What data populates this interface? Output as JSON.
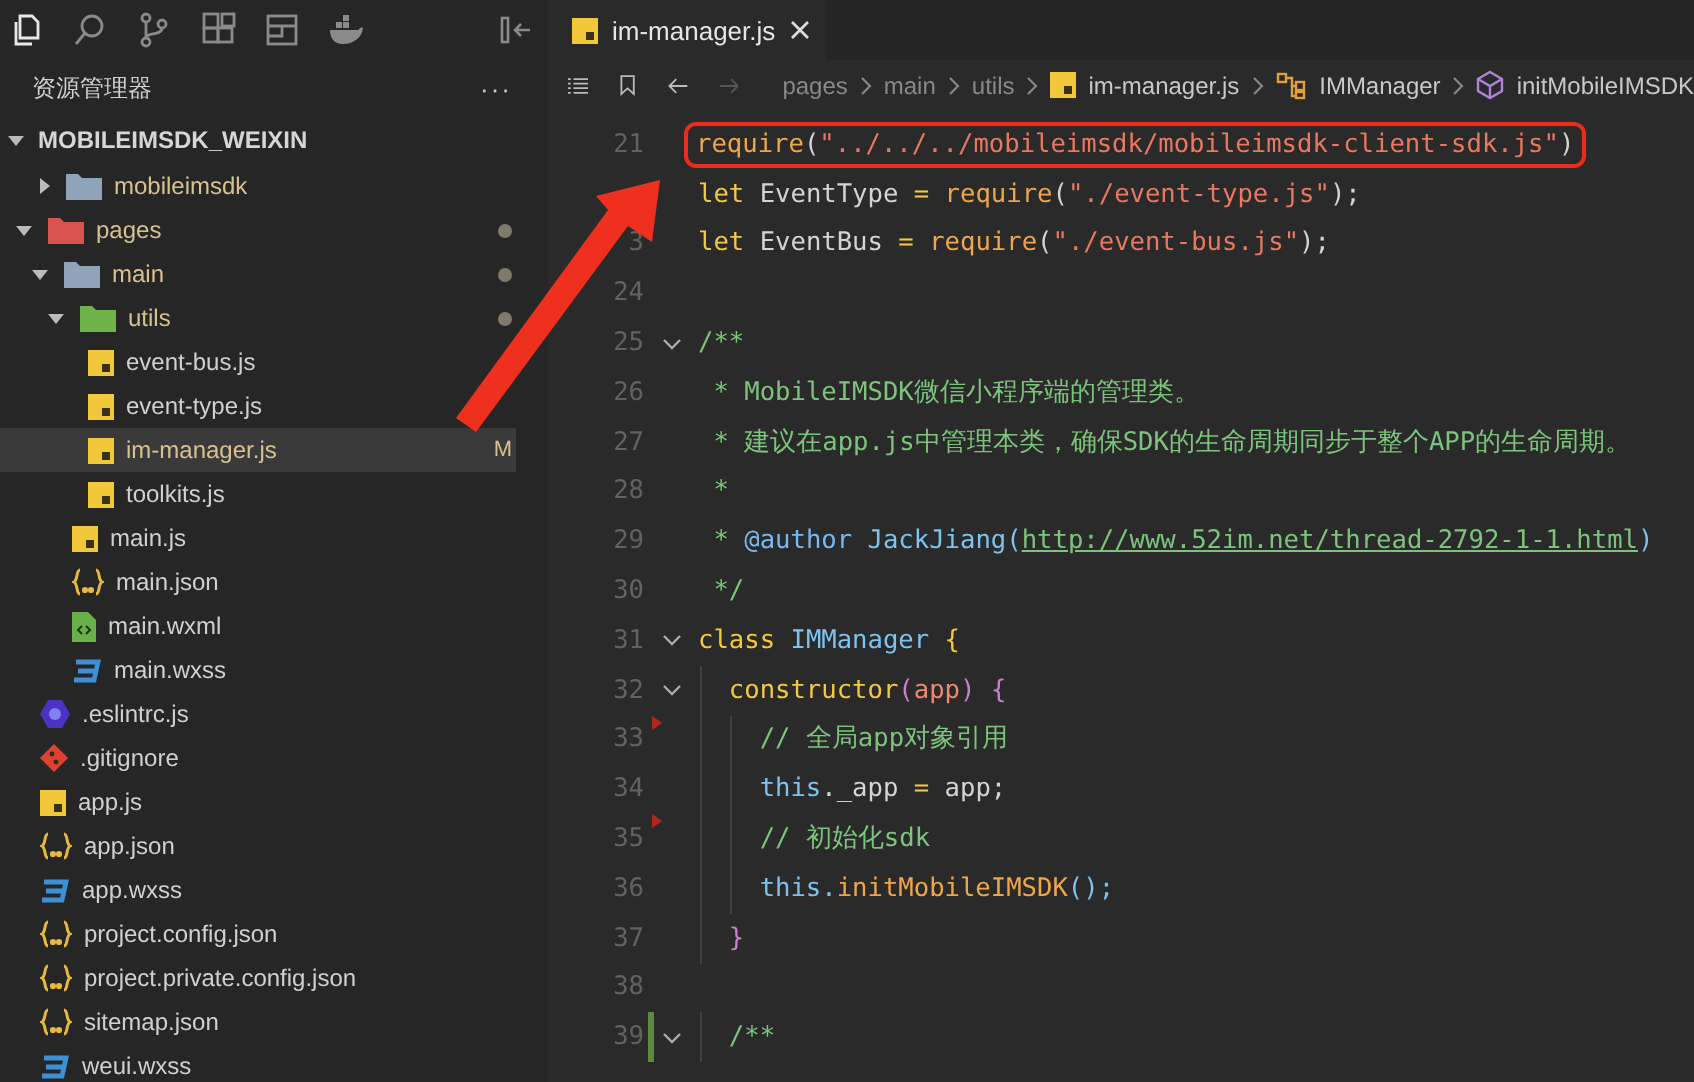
{
  "activity_bar": {
    "icons": [
      {
        "kind": "files",
        "selected": true
      },
      {
        "kind": "search",
        "selected": false
      },
      {
        "kind": "branch",
        "selected": false
      },
      {
        "kind": "extensions",
        "selected": false
      },
      {
        "kind": "panel",
        "selected": false
      },
      {
        "kind": "whale",
        "selected": false
      }
    ]
  },
  "sidebar": {
    "title": "资源管理器",
    "more": "···",
    "root": {
      "label": "MOBILEIMSDK_WEIXIN",
      "expanded": true
    },
    "items": [
      {
        "label": "mobileimsdk",
        "kind": "folder",
        "expanded": false,
        "modified": true,
        "selected": false
      },
      {
        "label": "pages",
        "kind": "folder-pages",
        "expanded": true,
        "modified": true,
        "selected": false,
        "children": [
          {
            "label": "main",
            "kind": "folder",
            "expanded": true,
            "modified": true,
            "selected": false,
            "children": [
              {
                "label": "utils",
                "kind": "folder-utils",
                "expanded": true,
                "modified": true,
                "selected": false,
                "children": [
                  {
                    "label": "event-bus.js",
                    "kind": "js",
                    "modified": false,
                    "selected": false
                  },
                  {
                    "label": "event-type.js",
                    "kind": "js",
                    "modified": false,
                    "selected": false
                  },
                  {
                    "label": "im-manager.js",
                    "kind": "js",
                    "modified": true,
                    "badge": "M",
                    "selected": true
                  },
                  {
                    "label": "toolkits.js",
                    "kind": "js",
                    "modified": false,
                    "selected": false
                  }
                ]
              },
              {
                "label": "main.js",
                "kind": "js",
                "modified": false,
                "selected": false
              },
              {
                "label": "main.json",
                "kind": "json",
                "modified": false,
                "selected": false
              },
              {
                "label": "main.wxml",
                "kind": "wxml",
                "modified": false,
                "selected": false
              },
              {
                "label": "main.wxss",
                "kind": "wxss",
                "modified": false,
                "selected": false
              }
            ]
          }
        ]
      },
      {
        "label": ".eslintrc.js",
        "kind": "eslint",
        "modified": false,
        "selected": false
      },
      {
        "label": ".gitignore",
        "kind": "git",
        "modified": false,
        "selected": false
      },
      {
        "label": "app.js",
        "kind": "js",
        "modified": false,
        "selected": false
      },
      {
        "label": "app.json",
        "kind": "json",
        "modified": false,
        "selected": false
      },
      {
        "label": "app.wxss",
        "kind": "wxss",
        "modified": false,
        "selected": false
      },
      {
        "label": "project.config.json",
        "kind": "json",
        "modified": false,
        "selected": false
      },
      {
        "label": "project.private.config.json",
        "kind": "json",
        "modified": false,
        "selected": false
      },
      {
        "label": "sitemap.json",
        "kind": "json",
        "modified": false,
        "selected": false
      },
      {
        "label": "weui.wxss",
        "kind": "wxss",
        "modified": false,
        "selected": false
      }
    ]
  },
  "tabs": [
    {
      "label": "im-manager.js",
      "kind": "js",
      "selected": true
    }
  ],
  "breadcrumbs": [
    {
      "label": "pages",
      "kind": "folder"
    },
    {
      "label": "main",
      "kind": "folder"
    },
    {
      "label": "utils",
      "kind": "folder"
    },
    {
      "label": "im-manager.js",
      "kind": "js"
    },
    {
      "label": "IMManager",
      "kind": "class"
    },
    {
      "label": "initMobileIMSDK",
      "kind": "method"
    }
  ],
  "code": [
    {
      "number": "21",
      "highlighted": true,
      "tokens": [
        {
          "kind": "fn",
          "text": "require"
        },
        {
          "kind": "plain",
          "text": "("
        },
        {
          "kind": "str",
          "text": "\"../../../mobileimsdk/mobileimsdk-client-sdk.js\""
        },
        {
          "kind": "plain",
          "text": ")"
        }
      ]
    },
    {
      "tokens": [
        {
          "kind": "kw",
          "text": "let"
        },
        {
          "kind": "plain",
          "text": " EventType "
        },
        {
          "kind": "kw",
          "text": "="
        },
        {
          "kind": "fn",
          "text": " require"
        },
        {
          "kind": "plain",
          "text": "("
        },
        {
          "kind": "str",
          "text": "\"./event-type.js\""
        },
        {
          "kind": "plain",
          "text": ");"
        }
      ]
    },
    {
      "number": "3",
      "tokens": [
        {
          "kind": "kw",
          "text": "let"
        },
        {
          "kind": "plain",
          "text": " EventBus "
        },
        {
          "kind": "kw",
          "text": "="
        },
        {
          "kind": "fn",
          "text": " require"
        },
        {
          "kind": "plain",
          "text": "("
        },
        {
          "kind": "str",
          "text": "\"./event-bus.js\""
        },
        {
          "kind": "plain",
          "text": ");"
        }
      ]
    },
    {
      "number": "24"
    },
    {
      "number": "25",
      "fold": true,
      "tokens": [
        {
          "kind": "cmt",
          "text": "/**"
        }
      ]
    },
    {
      "number": "26",
      "tokens": [
        {
          "kind": "cmt",
          "text": " * MobileIMSDK微信小程序端的管理类。"
        }
      ]
    },
    {
      "number": "27",
      "tokens": [
        {
          "kind": "cmt",
          "text": " * 建议在app.js中管理本类，确保SDK的生命周期同步于整个APP的生命周期。"
        }
      ]
    },
    {
      "number": "28",
      "tokens": [
        {
          "kind": "cmt",
          "text": " *"
        }
      ]
    },
    {
      "number": "29",
      "tokens": [
        {
          "kind": "cmt",
          "text": " * "
        },
        {
          "kind": "tag",
          "text": "@author"
        },
        {
          "kind": "type",
          "text": " JackJiang"
        },
        {
          "kind": "type",
          "text": "("
        },
        {
          "kind": "link",
          "text": "http://www.52im.net/thread-2792-1-1.html"
        },
        {
          "kind": "type",
          "text": ")"
        }
      ]
    },
    {
      "number": "30",
      "tokens": [
        {
          "kind": "cmt",
          "text": " */"
        }
      ]
    },
    {
      "number": "31",
      "fold": true,
      "tokens": [
        {
          "kind": "kw",
          "text": "class"
        },
        {
          "kind": "type",
          "text": " IMManager"
        },
        {
          "kind": "kw",
          "text": " {"
        }
      ]
    },
    {
      "number": "32",
      "fold": true,
      "tokens": [
        {
          "kind": "kw",
          "text": "  constructor"
        },
        {
          "kind": "brace",
          "text": "("
        },
        {
          "kind": "param",
          "text": "app"
        },
        {
          "kind": "brace",
          "text": ")"
        },
        {
          "kind": "brace",
          "text": " {"
        }
      ]
    },
    {
      "number": "33",
      "marker": true,
      "tokens": [
        {
          "kind": "cmt",
          "text": "    // 全局app对象引用"
        }
      ]
    },
    {
      "number": "34",
      "tokens": [
        {
          "kind": "type",
          "text": "    this"
        },
        {
          "kind": "plain",
          "text": "._app "
        },
        {
          "kind": "kw",
          "text": "="
        },
        {
          "kind": "plain",
          "text": " app;"
        }
      ]
    },
    {
      "number": "35",
      "marker": true,
      "tokens": [
        {
          "kind": "cmt",
          "text": "    // 初始化sdk"
        }
      ]
    },
    {
      "number": "36",
      "tokens": [
        {
          "kind": "type",
          "text": "    this."
        },
        {
          "kind": "fn",
          "text": "initMobileIMSDK"
        },
        {
          "kind": "type",
          "text": "();"
        }
      ]
    },
    {
      "number": "37",
      "tokens": [
        {
          "kind": "brace",
          "text": "  }"
        }
      ]
    },
    {
      "number": "38"
    },
    {
      "number": "39",
      "fold": true,
      "modified": true,
      "tokens": [
        {
          "kind": "cmt",
          "text": "  /**"
        }
      ]
    }
  ]
}
